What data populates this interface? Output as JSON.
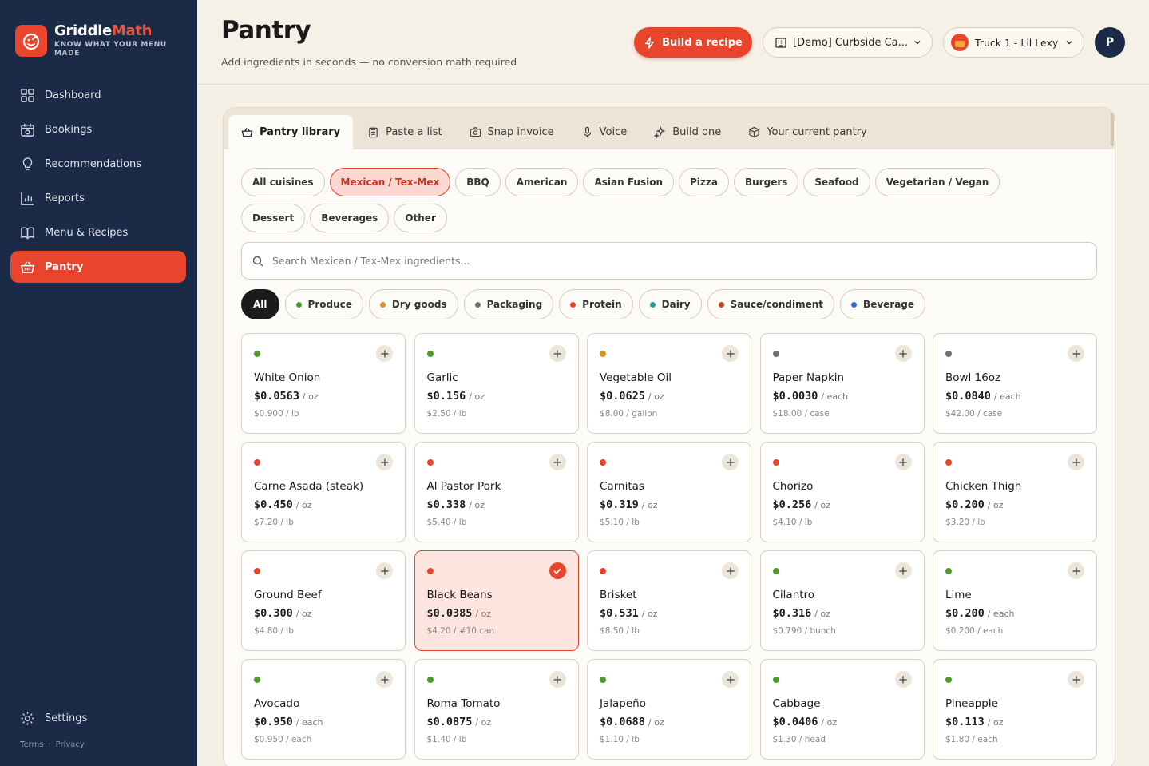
{
  "brand": {
    "name_a": "Griddle",
    "name_b": "Math",
    "tagline": "KNOW WHAT YOUR MENU MADE"
  },
  "nav": [
    {
      "label": "Dashboard",
      "icon": "dashboard-icon"
    },
    {
      "label": "Bookings",
      "icon": "calendar-icon"
    },
    {
      "label": "Recommendations",
      "icon": "lightbulb-icon"
    },
    {
      "label": "Reports",
      "icon": "bar-chart-icon"
    },
    {
      "label": "Menu & Recipes",
      "icon": "book-icon"
    },
    {
      "label": "Pantry",
      "icon": "basket-icon",
      "active": true
    }
  ],
  "settings_label": "Settings",
  "legal": {
    "terms": "Terms",
    "sep": "·",
    "privacy": "Privacy"
  },
  "header": {
    "title": "Pantry",
    "subtitle": "Add ingredients in seconds — no conversion math required",
    "build_label": "Build a recipe",
    "location": "[Demo] Curbside Ca...",
    "truck": "Truck 1 - Lil Lexy",
    "avatar_initial": "P"
  },
  "tabs": [
    "Pantry library",
    "Paste a list",
    "Snap invoice",
    "Voice",
    "Build one",
    "Your current pantry"
  ],
  "cuisines": [
    "All cuisines",
    "Mexican / Tex-Mex",
    "BBQ",
    "American",
    "Asian Fusion",
    "Pizza",
    "Burgers",
    "Seafood",
    "Vegetarian / Vegan",
    "Dessert",
    "Beverages",
    "Other"
  ],
  "active_cuisine": "Mexican / Tex-Mex",
  "search": {
    "placeholder": "Search Mexican / Tex-Mex ingredients..."
  },
  "categories": [
    {
      "label": "All",
      "color": ""
    },
    {
      "label": "Produce",
      "color": "#4e9a2a"
    },
    {
      "label": "Dry goods",
      "color": "#d4922a"
    },
    {
      "label": "Packaging",
      "color": "#76706a"
    },
    {
      "label": "Protein",
      "color": "#e8452c"
    },
    {
      "label": "Dairy",
      "color": "#2a9a9a"
    },
    {
      "label": "Sauce/condiment",
      "color": "#c0501e"
    },
    {
      "label": "Beverage",
      "color": "#3a6bc8"
    }
  ],
  "colors": {
    "produce": "#4e9a2a",
    "dry": "#d4922a",
    "packaging": "#76706a",
    "protein": "#e8452c",
    "accent": "#e8452c",
    "sidebar": "#1b2a47"
  },
  "ingredients": [
    {
      "name": "White Onion",
      "price": "$0.0563",
      "unit": "/ oz",
      "pack": "$0.900 / lb",
      "cat": "produce"
    },
    {
      "name": "Garlic",
      "price": "$0.156",
      "unit": "/ oz",
      "pack": "$2.50 / lb",
      "cat": "produce"
    },
    {
      "name": "Vegetable Oil",
      "price": "$0.0625",
      "unit": "/ oz",
      "pack": "$8.00 / gallon",
      "cat": "dry"
    },
    {
      "name": "Paper Napkin",
      "price": "$0.0030",
      "unit": "/ each",
      "pack": "$18.00 / case",
      "cat": "packaging"
    },
    {
      "name": "Bowl 16oz",
      "price": "$0.0840",
      "unit": "/ each",
      "pack": "$42.00 / case",
      "cat": "packaging"
    },
    {
      "name": "Carne Asada (steak)",
      "price": "$0.450",
      "unit": "/ oz",
      "pack": "$7.20 / lb",
      "cat": "protein"
    },
    {
      "name": "Al Pastor Pork",
      "price": "$0.338",
      "unit": "/ oz",
      "pack": "$5.40 / lb",
      "cat": "protein"
    },
    {
      "name": "Carnitas",
      "price": "$0.319",
      "unit": "/ oz",
      "pack": "$5.10 / lb",
      "cat": "protein"
    },
    {
      "name": "Chorizo",
      "price": "$0.256",
      "unit": "/ oz",
      "pack": "$4.10 / lb",
      "cat": "protein"
    },
    {
      "name": "Chicken Thigh",
      "price": "$0.200",
      "unit": "/ oz",
      "pack": "$3.20 / lb",
      "cat": "protein"
    },
    {
      "name": "Ground Beef",
      "price": "$0.300",
      "unit": "/ oz",
      "pack": "$4.80 / lb",
      "cat": "protein"
    },
    {
      "name": "Black Beans",
      "price": "$0.0385",
      "unit": "/ oz",
      "pack": "$4.20 / #10 can",
      "cat": "protein",
      "selected": true
    },
    {
      "name": "Brisket",
      "price": "$0.531",
      "unit": "/ oz",
      "pack": "$8.50 / lb",
      "cat": "protein"
    },
    {
      "name": "Cilantro",
      "price": "$0.316",
      "unit": "/ oz",
      "pack": "$0.790 / bunch",
      "cat": "produce"
    },
    {
      "name": "Lime",
      "price": "$0.200",
      "unit": "/ each",
      "pack": "$0.200 / each",
      "cat": "produce"
    },
    {
      "name": "Avocado",
      "price": "$0.950",
      "unit": "/ each",
      "pack": "$0.950 / each",
      "cat": "produce"
    },
    {
      "name": "Roma Tomato",
      "price": "$0.0875",
      "unit": "/ oz",
      "pack": "$1.40 / lb",
      "cat": "produce"
    },
    {
      "name": "Jalapeño",
      "price": "$0.0688",
      "unit": "/ oz",
      "pack": "$1.10 / lb",
      "cat": "produce"
    },
    {
      "name": "Cabbage",
      "price": "$0.0406",
      "unit": "/ oz",
      "pack": "$1.30 / head",
      "cat": "produce"
    },
    {
      "name": "Pineapple",
      "price": "$0.113",
      "unit": "/ oz",
      "pack": "$1.80 / each",
      "cat": "produce"
    }
  ]
}
